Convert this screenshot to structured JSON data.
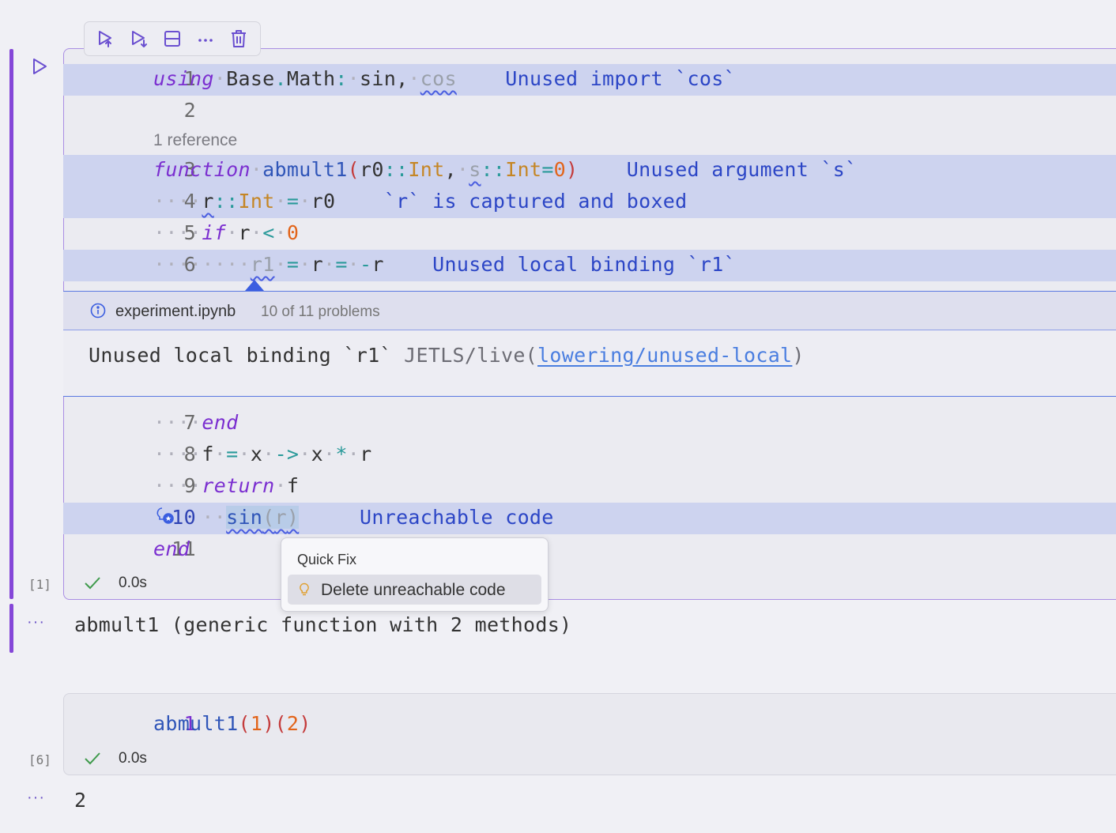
{
  "cell1": {
    "exec_count": "[1]",
    "status_time": "0.0s",
    "codelens": "1 reference",
    "lines": [
      {
        "num": "1"
      },
      {
        "num": "2"
      },
      {
        "num": "3"
      },
      {
        "num": "4"
      },
      {
        "num": "5"
      },
      {
        "num": "6"
      },
      {
        "num": "7"
      },
      {
        "num": "8"
      },
      {
        "num": "9"
      },
      {
        "num": "10"
      },
      {
        "num": "11"
      }
    ],
    "diagnostics": {
      "line1": "Unused import `cos`",
      "line3": "Unused argument `s`",
      "line4": "`r` is captured and boxed",
      "line6": "Unused local binding `r1`",
      "line10": "Unreachable code"
    },
    "output": "abmult1 (generic function with 2 methods)"
  },
  "peek": {
    "file": "experiment.ipynb",
    "count": "10 of 11 problems",
    "message": "Unused local binding `r1`",
    "source_prefix": "JETLS/live(",
    "source_link": "lowering/unused-local",
    "source_suffix": ")"
  },
  "quick_fix": {
    "title": "Quick Fix",
    "item": "Delete unreachable code"
  },
  "cell2": {
    "exec_count": "[6]",
    "line_num": "1",
    "status_time": "0.0s",
    "output": "2"
  },
  "ellipsis": "···",
  "colors": {
    "accent": "#8547d8",
    "highlight": "#cdd3ef",
    "diagnostic": "#2c46c6",
    "keyword": "#7b2fd0",
    "type": "#c58625",
    "number": "#e2641a"
  }
}
